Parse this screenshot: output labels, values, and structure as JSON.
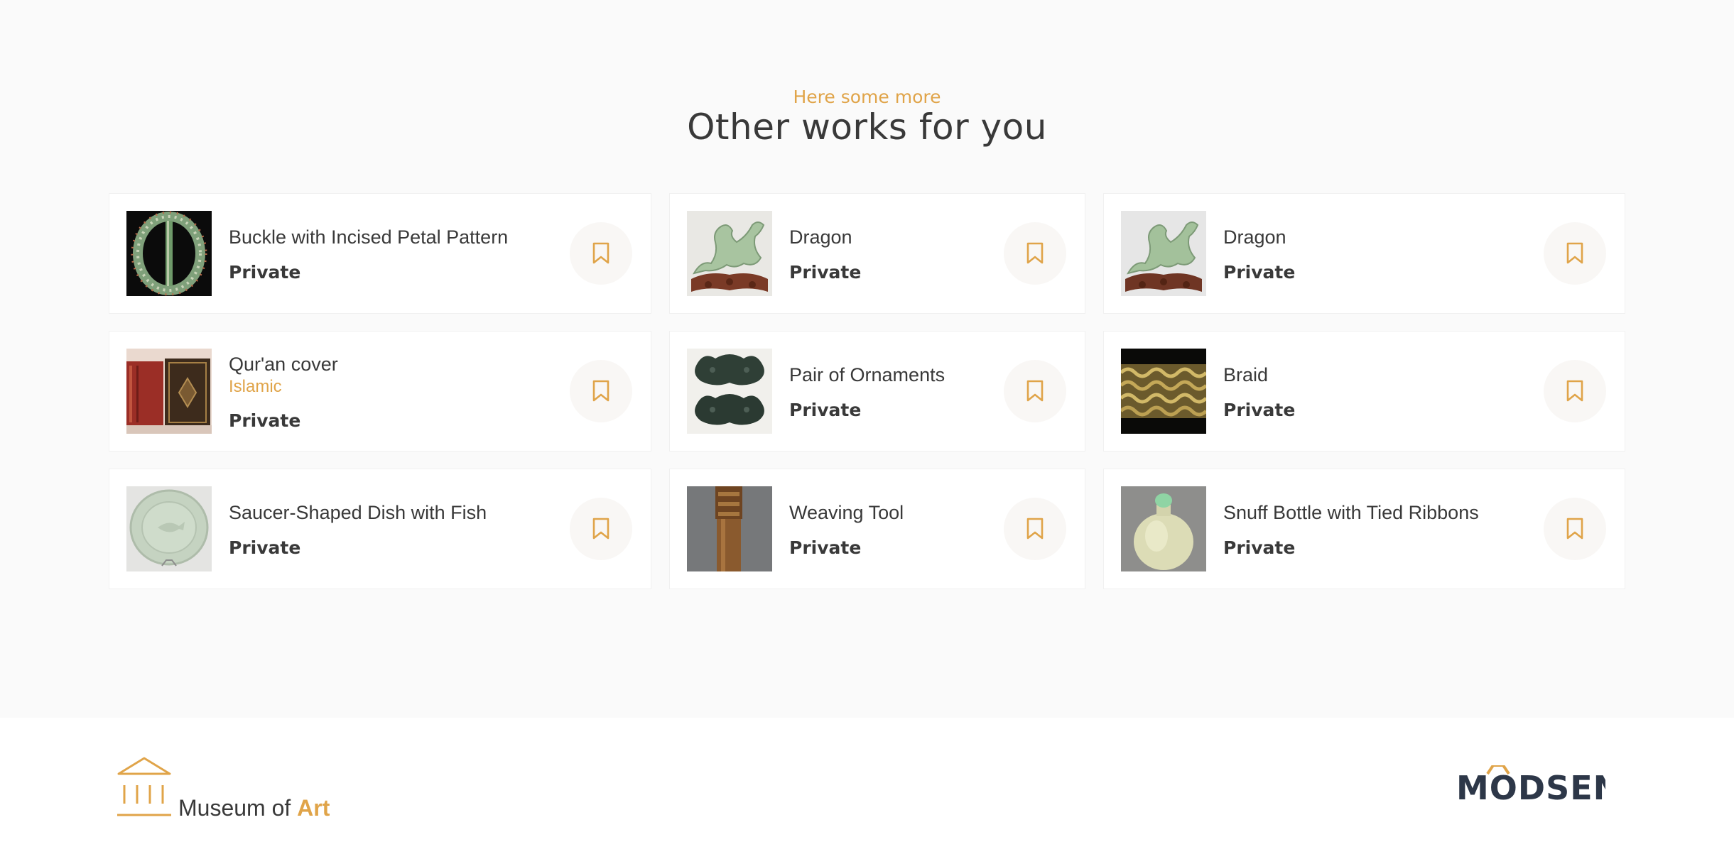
{
  "section": {
    "eyebrow": "Here some more",
    "heading": "Other works for you"
  },
  "cards": [
    {
      "title": "Buckle with Incised Petal Pattern",
      "subtitle": "",
      "status": "Private",
      "image": "buckle-image"
    },
    {
      "title": "Dragon",
      "subtitle": "",
      "status": "Private",
      "image": "dragon-image"
    },
    {
      "title": "Dragon",
      "subtitle": "",
      "status": "Private",
      "image": "dragon-image"
    },
    {
      "title": "Qur'an cover",
      "subtitle": "Islamic",
      "status": "Private",
      "image": "quran-cover-image"
    },
    {
      "title": "Pair of Ornaments",
      "subtitle": "",
      "status": "Private",
      "image": "ornaments-image"
    },
    {
      "title": "Braid",
      "subtitle": "",
      "status": "Private",
      "image": "braid-image"
    },
    {
      "title": "Saucer-Shaped Dish with Fish",
      "subtitle": "",
      "status": "Private",
      "image": "dish-image"
    },
    {
      "title": "Weaving Tool",
      "subtitle": "",
      "status": "Private",
      "image": "weaving-tool-image"
    },
    {
      "title": "Snuff Bottle with Tied Ribbons",
      "subtitle": "",
      "status": "Private",
      "image": "snuff-bottle-image"
    }
  ],
  "footer": {
    "logo_prefix": "Museum of ",
    "logo_accent": "Art",
    "partner_logo": "MODSEN"
  },
  "colors": {
    "accent": "#e0a449",
    "text": "#393939",
    "background": "#fafafa"
  }
}
